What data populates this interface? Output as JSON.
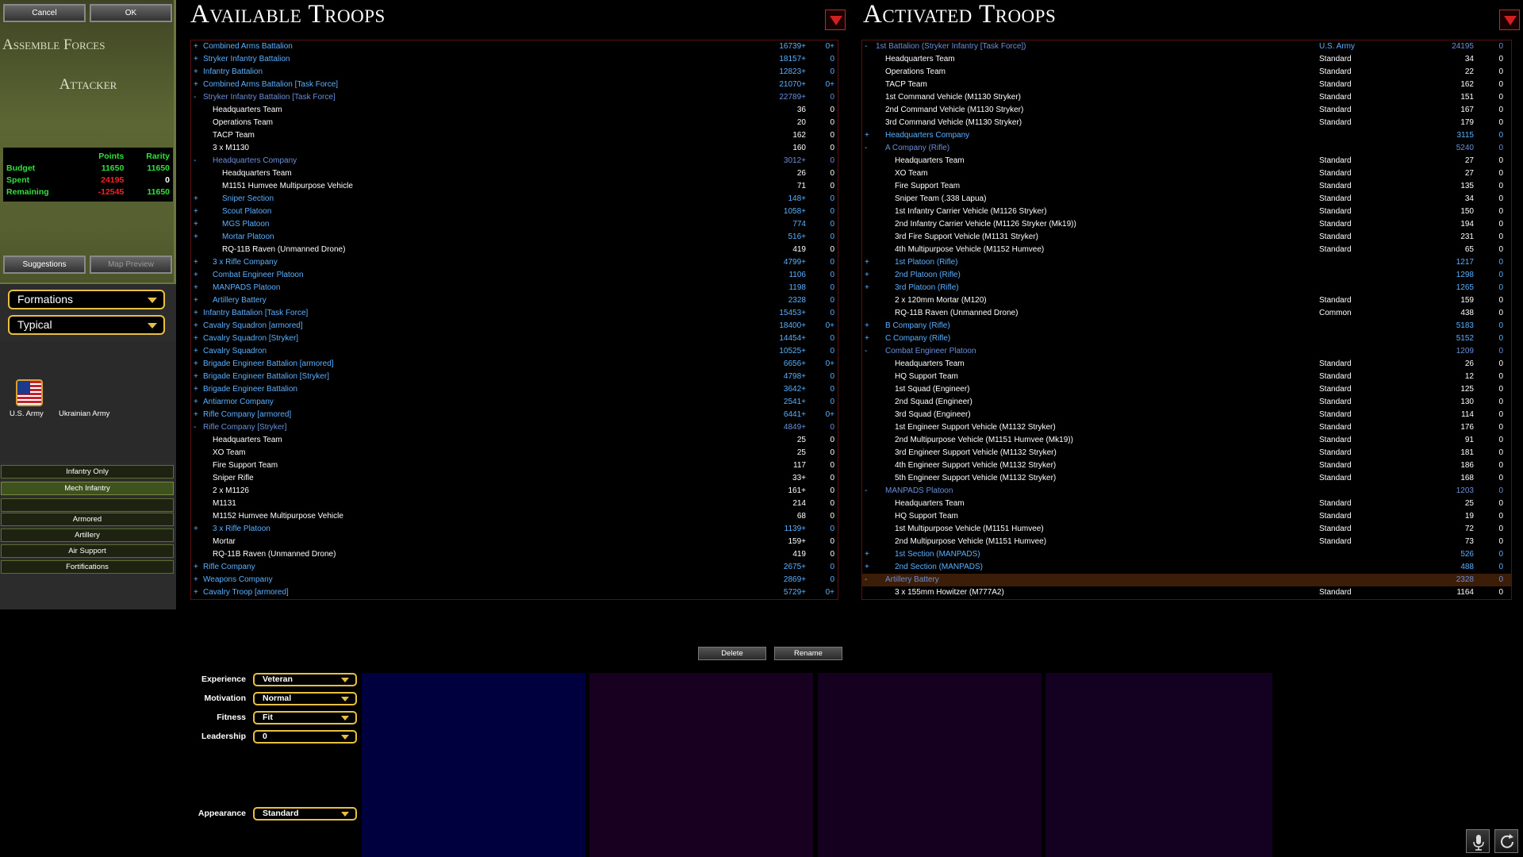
{
  "top_buttons": {
    "cancel": "Cancel",
    "ok": "OK"
  },
  "assemble_title": "Assemble Forces",
  "side": "Attacker",
  "budget": {
    "header": {
      "points": "Points",
      "rarity": "Rarity"
    },
    "rows": [
      {
        "label": "Budget",
        "points": "11650",
        "rarity": "11650"
      },
      {
        "label": "Spent",
        "points": "24195",
        "rarity": "0"
      },
      {
        "label": "Remaining",
        "points": "-12545",
        "rarity": "11650"
      }
    ]
  },
  "buttons": {
    "suggestions": "Suggestions",
    "map_preview": "Map Preview"
  },
  "selects": {
    "formations": "Formations",
    "typical": "Typical"
  },
  "countries": {
    "us": "U.S. Army",
    "ua": "Ukrainian Army"
  },
  "filters": {
    "infantry_only": "Infantry Only",
    "mech_infantry": "Mech Infantry",
    "armored": "Armored",
    "artillery": "Artillery",
    "air_support": "Air Support",
    "fortifications": "Fortifications"
  },
  "titles": {
    "available": "Available Troops",
    "activated": "Activated Troops"
  },
  "available_troops": [
    {
      "exp": "+",
      "name": "Combined Arms Battalion",
      "points": "16739+",
      "rar": "0+",
      "indent": 0,
      "style": "blue"
    },
    {
      "exp": "+",
      "name": "Stryker Infantry Battalion",
      "points": "18157+",
      "rar": "0",
      "indent": 0,
      "style": "blue"
    },
    {
      "exp": "+",
      "name": "Infantry Battalion",
      "points": "12823+",
      "rar": "0",
      "indent": 0,
      "style": "blue"
    },
    {
      "exp": "+",
      "name": "Combined Arms Battalion [Task Force]",
      "points": "21070+",
      "rar": "0+",
      "indent": 0,
      "style": "blue"
    },
    {
      "exp": "-",
      "name": "Stryker Infantry Battalion [Task Force]",
      "points": "22789+",
      "rar": "0",
      "indent": 0,
      "style": "dim"
    },
    {
      "exp": "",
      "name": "Headquarters Team",
      "points": "36",
      "rar": "0",
      "indent": 1,
      "style": "white"
    },
    {
      "exp": "",
      "name": "Operations Team",
      "points": "20",
      "rar": "0",
      "indent": 1,
      "style": "white"
    },
    {
      "exp": "",
      "name": "TACP Team",
      "points": "162",
      "rar": "0",
      "indent": 1,
      "style": "white"
    },
    {
      "exp": "",
      "name": "3 x M1130",
      "points": "160",
      "rar": "0",
      "indent": 1,
      "style": "white"
    },
    {
      "exp": "-",
      "name": "Headquarters Company",
      "points": "3012+",
      "rar": "0",
      "indent": 1,
      "style": "dim"
    },
    {
      "exp": "",
      "name": "Headquarters Team",
      "points": "26",
      "rar": "0",
      "indent": 2,
      "style": "white"
    },
    {
      "exp": "",
      "name": "M1151 Humvee Multipurpose Vehicle",
      "points": "71",
      "rar": "0",
      "indent": 2,
      "style": "white"
    },
    {
      "exp": "+",
      "name": "Sniper Section",
      "points": "148+",
      "rar": "0",
      "indent": 2,
      "style": "blue"
    },
    {
      "exp": "+",
      "name": "Scout Platoon",
      "points": "1058+",
      "rar": "0",
      "indent": 2,
      "style": "blue"
    },
    {
      "exp": "+",
      "name": "MGS Platoon",
      "points": "774",
      "rar": "0",
      "indent": 2,
      "style": "blue"
    },
    {
      "exp": "+",
      "name": "Mortar Platoon",
      "points": "516+",
      "rar": "0",
      "indent": 2,
      "style": "blue"
    },
    {
      "exp": "",
      "name": "RQ-11B Raven (Unmanned Drone)",
      "points": "419",
      "rar": "0",
      "indent": 2,
      "style": "white"
    },
    {
      "exp": "+",
      "name": "3 x Rifle Company",
      "points": "4799+",
      "rar": "0",
      "indent": 1,
      "style": "blue"
    },
    {
      "exp": "+",
      "name": "Combat Engineer Platoon",
      "points": "1106",
      "rar": "0",
      "indent": 1,
      "style": "blue"
    },
    {
      "exp": "+",
      "name": "MANPADS Platoon",
      "points": "1198",
      "rar": "0",
      "indent": 1,
      "style": "blue"
    },
    {
      "exp": "+",
      "name": "Artillery Battery",
      "points": "2328",
      "rar": "0",
      "indent": 1,
      "style": "blue"
    },
    {
      "exp": "+",
      "name": "Infantry Battalion [Task Force]",
      "points": "15453+",
      "rar": "0",
      "indent": 0,
      "style": "blue"
    },
    {
      "exp": "+",
      "name": "Cavalry Squadron [armored]",
      "points": "18400+",
      "rar": "0+",
      "indent": 0,
      "style": "blue"
    },
    {
      "exp": "+",
      "name": "Cavalry Squadron [Stryker]",
      "points": "14454+",
      "rar": "0",
      "indent": 0,
      "style": "blue"
    },
    {
      "exp": "+",
      "name": "Cavalry Squadron",
      "points": "10525+",
      "rar": "0",
      "indent": 0,
      "style": "blue"
    },
    {
      "exp": "+",
      "name": "Brigade Engineer Battalion [armored]",
      "points": "6656+",
      "rar": "0+",
      "indent": 0,
      "style": "blue"
    },
    {
      "exp": "+",
      "name": "Brigade Engineer Battalion [Stryker]",
      "points": "4798+",
      "rar": "0",
      "indent": 0,
      "style": "blue"
    },
    {
      "exp": "+",
      "name": "Brigade Engineer Battalion",
      "points": "3642+",
      "rar": "0",
      "indent": 0,
      "style": "blue"
    },
    {
      "exp": "+",
      "name": "Antiarmor Company",
      "points": "2541+",
      "rar": "0",
      "indent": 0,
      "style": "blue"
    },
    {
      "exp": "+",
      "name": "Rifle Company [armored]",
      "points": "6441+",
      "rar": "0+",
      "indent": 0,
      "style": "blue"
    },
    {
      "exp": "-",
      "name": "Rifle Company [Stryker]",
      "points": "4849+",
      "rar": "0",
      "indent": 0,
      "style": "dim"
    },
    {
      "exp": "",
      "name": "Headquarters Team",
      "points": "25",
      "rar": "0",
      "indent": 1,
      "style": "white"
    },
    {
      "exp": "",
      "name": "XO Team",
      "points": "25",
      "rar": "0",
      "indent": 1,
      "style": "white"
    },
    {
      "exp": "",
      "name": "Fire Support Team",
      "points": "117",
      "rar": "0",
      "indent": 1,
      "style": "white"
    },
    {
      "exp": "",
      "name": "Sniper Rifle",
      "points": "33+",
      "rar": "0",
      "indent": 1,
      "style": "white"
    },
    {
      "exp": "",
      "name": "2 x M1126",
      "points": "161+",
      "rar": "0",
      "indent": 1,
      "style": "white"
    },
    {
      "exp": "",
      "name": "M1131",
      "points": "214",
      "rar": "0",
      "indent": 1,
      "style": "white"
    },
    {
      "exp": "",
      "name": "M1152 Humvee Multipurpose Vehicle",
      "points": "68",
      "rar": "0",
      "indent": 1,
      "style": "white"
    },
    {
      "exp": "+",
      "name": "3 x Rifle Platoon",
      "points": "1139+",
      "rar": "0",
      "indent": 1,
      "style": "blue"
    },
    {
      "exp": "",
      "name": "Mortar",
      "points": "159+",
      "rar": "0",
      "indent": 1,
      "style": "white"
    },
    {
      "exp": "",
      "name": "RQ-11B Raven (Unmanned Drone)",
      "points": "419",
      "rar": "0",
      "indent": 1,
      "style": "white"
    },
    {
      "exp": "+",
      "name": "Rifle Company",
      "points": "2675+",
      "rar": "0",
      "indent": 0,
      "style": "blue"
    },
    {
      "exp": "+",
      "name": "Weapons Company",
      "points": "2869+",
      "rar": "0",
      "indent": 0,
      "style": "blue"
    },
    {
      "exp": "+",
      "name": "Cavalry Troop [armored]",
      "points": "5729+",
      "rar": "0+",
      "indent": 0,
      "style": "blue"
    }
  ],
  "activated_troops": [
    {
      "exp": "-",
      "name": "1st Battalion (Stryker Infantry [Task Force])",
      "rarity": "U.S. Army",
      "points": "24195",
      "rar": "0",
      "indent": 0,
      "style": "dim"
    },
    {
      "exp": "",
      "name": "Headquarters Team",
      "rarity": "Standard",
      "points": "34",
      "rar": "0",
      "indent": 1,
      "style": "white"
    },
    {
      "exp": "",
      "name": "Operations Team",
      "rarity": "Standard",
      "points": "22",
      "rar": "0",
      "indent": 1,
      "style": "white"
    },
    {
      "exp": "",
      "name": "TACP Team",
      "rarity": "Standard",
      "points": "162",
      "rar": "0",
      "indent": 1,
      "style": "white"
    },
    {
      "exp": "",
      "name": "1st Command Vehicle (M1130 Stryker)",
      "rarity": "Standard",
      "points": "151",
      "rar": "0",
      "indent": 1,
      "style": "white"
    },
    {
      "exp": "",
      "name": "2nd Command Vehicle (M1130 Stryker)",
      "rarity": "Standard",
      "points": "167",
      "rar": "0",
      "indent": 1,
      "style": "white"
    },
    {
      "exp": "",
      "name": "3rd Command Vehicle (M1130 Stryker)",
      "rarity": "Standard",
      "points": "179",
      "rar": "0",
      "indent": 1,
      "style": "white"
    },
    {
      "exp": "+",
      "name": "Headquarters Company",
      "rarity": "",
      "points": "3115",
      "rar": "0",
      "indent": 1,
      "style": "blue"
    },
    {
      "exp": "-",
      "name": "A Company (Rifle)",
      "rarity": "",
      "points": "5240",
      "rar": "0",
      "indent": 1,
      "style": "dim"
    },
    {
      "exp": "",
      "name": "Headquarters Team",
      "rarity": "Standard",
      "points": "27",
      "rar": "0",
      "indent": 2,
      "style": "white"
    },
    {
      "exp": "",
      "name": "XO Team",
      "rarity": "Standard",
      "points": "27",
      "rar": "0",
      "indent": 2,
      "style": "white"
    },
    {
      "exp": "",
      "name": "Fire Support Team",
      "rarity": "Standard",
      "points": "135",
      "rar": "0",
      "indent": 2,
      "style": "white"
    },
    {
      "exp": "",
      "name": "Sniper Team (.338 Lapua)",
      "rarity": "Standard",
      "points": "34",
      "rar": "0",
      "indent": 2,
      "style": "white"
    },
    {
      "exp": "",
      "name": "1st Infantry Carrier Vehicle (M1126 Stryker)",
      "rarity": "Standard",
      "points": "150",
      "rar": "0",
      "indent": 2,
      "style": "white"
    },
    {
      "exp": "",
      "name": "2nd Infantry Carrier Vehicle (M1126 Stryker (Mk19))",
      "rarity": "Standard",
      "points": "194",
      "rar": "0",
      "indent": 2,
      "style": "white"
    },
    {
      "exp": "",
      "name": "3rd Fire Support Vehicle (M1131 Stryker)",
      "rarity": "Standard",
      "points": "231",
      "rar": "0",
      "indent": 2,
      "style": "white"
    },
    {
      "exp": "",
      "name": "4th Multipurpose Vehicle (M1152 Humvee)",
      "rarity": "Standard",
      "points": "65",
      "rar": "0",
      "indent": 2,
      "style": "white"
    },
    {
      "exp": "+",
      "name": "1st Platoon (Rifle)",
      "rarity": "",
      "points": "1217",
      "rar": "0",
      "indent": 2,
      "style": "blue"
    },
    {
      "exp": "+",
      "name": "2nd Platoon (Rifle)",
      "rarity": "",
      "points": "1298",
      "rar": "0",
      "indent": 2,
      "style": "blue"
    },
    {
      "exp": "+",
      "name": "3rd Platoon (Rifle)",
      "rarity": "",
      "points": "1265",
      "rar": "0",
      "indent": 2,
      "style": "blue"
    },
    {
      "exp": "",
      "name": "2 x 120mm Mortar (M120)",
      "rarity": "Standard",
      "points": "159",
      "rar": "0",
      "indent": 2,
      "style": "white"
    },
    {
      "exp": "",
      "name": "RQ-11B Raven (Unmanned Drone)",
      "rarity": "Common",
      "points": "438",
      "rar": "0",
      "indent": 2,
      "style": "white"
    },
    {
      "exp": "+",
      "name": "B Company (Rifle)",
      "rarity": "",
      "points": "5183",
      "rar": "0",
      "indent": 1,
      "style": "blue"
    },
    {
      "exp": "+",
      "name": "C Company (Rifle)",
      "rarity": "",
      "points": "5152",
      "rar": "0",
      "indent": 1,
      "style": "blue"
    },
    {
      "exp": "-",
      "name": "Combat Engineer Platoon",
      "rarity": "",
      "points": "1209",
      "rar": "0",
      "indent": 1,
      "style": "dim"
    },
    {
      "exp": "",
      "name": "Headquarters Team",
      "rarity": "Standard",
      "points": "26",
      "rar": "0",
      "indent": 2,
      "style": "white"
    },
    {
      "exp": "",
      "name": "HQ Support Team",
      "rarity": "Standard",
      "points": "12",
      "rar": "0",
      "indent": 2,
      "style": "white"
    },
    {
      "exp": "",
      "name": "1st Squad (Engineer)",
      "rarity": "Standard",
      "points": "125",
      "rar": "0",
      "indent": 2,
      "style": "white"
    },
    {
      "exp": "",
      "name": "2nd Squad (Engineer)",
      "rarity": "Standard",
      "points": "130",
      "rar": "0",
      "indent": 2,
      "style": "white"
    },
    {
      "exp": "",
      "name": "3rd Squad (Engineer)",
      "rarity": "Standard",
      "points": "114",
      "rar": "0",
      "indent": 2,
      "style": "white"
    },
    {
      "exp": "",
      "name": "1st Engineer Support Vehicle (M1132 Stryker)",
      "rarity": "Standard",
      "points": "176",
      "rar": "0",
      "indent": 2,
      "style": "white"
    },
    {
      "exp": "",
      "name": "2nd Multipurpose Vehicle (M1151 Humvee (Mk19))",
      "rarity": "Standard",
      "points": "91",
      "rar": "0",
      "indent": 2,
      "style": "white"
    },
    {
      "exp": "",
      "name": "3rd Engineer Support Vehicle (M1132 Stryker)",
      "rarity": "Standard",
      "points": "181",
      "rar": "0",
      "indent": 2,
      "style": "white"
    },
    {
      "exp": "",
      "name": "4th Engineer Support Vehicle (M1132 Stryker)",
      "rarity": "Standard",
      "points": "186",
      "rar": "0",
      "indent": 2,
      "style": "white"
    },
    {
      "exp": "",
      "name": "5th Engineer Support Vehicle (M1132 Stryker)",
      "rarity": "Standard",
      "points": "168",
      "rar": "0",
      "indent": 2,
      "style": "white"
    },
    {
      "exp": "-",
      "name": "MANPADS Platoon",
      "rarity": "",
      "points": "1203",
      "rar": "0",
      "indent": 1,
      "style": "dim"
    },
    {
      "exp": "",
      "name": "Headquarters Team",
      "rarity": "Standard",
      "points": "25",
      "rar": "0",
      "indent": 2,
      "style": "white"
    },
    {
      "exp": "",
      "name": "HQ Support Team",
      "rarity": "Standard",
      "points": "19",
      "rar": "0",
      "indent": 2,
      "style": "white"
    },
    {
      "exp": "",
      "name": "1st Multipurpose Vehicle (M1151 Humvee)",
      "rarity": "Standard",
      "points": "72",
      "rar": "0",
      "indent": 2,
      "style": "white"
    },
    {
      "exp": "",
      "name": "2nd Multipurpose Vehicle (M1151 Humvee)",
      "rarity": "Standard",
      "points": "73",
      "rar": "0",
      "indent": 2,
      "style": "white"
    },
    {
      "exp": "+",
      "name": "1st Section (MANPADS)",
      "rarity": "",
      "points": "526",
      "rar": "0",
      "indent": 2,
      "style": "blue"
    },
    {
      "exp": "+",
      "name": "2nd Section (MANPADS)",
      "rarity": "",
      "points": "488",
      "rar": "0",
      "indent": 2,
      "style": "blue"
    },
    {
      "exp": "-",
      "name": "Artillery Battery",
      "rarity": "",
      "points": "2328",
      "rar": "0",
      "indent": 1,
      "style": "dim",
      "selected": true
    },
    {
      "exp": "",
      "name": "3 x 155mm Howitzer (M777A2)",
      "rarity": "Standard",
      "points": "1164",
      "rar": "0",
      "indent": 2,
      "style": "white"
    }
  ],
  "bottom_buttons": {
    "delete": "Delete",
    "rename": "Rename"
  },
  "attributes": {
    "experience": {
      "label": "Experience",
      "value": "Veteran"
    },
    "motivation": {
      "label": "Motivation",
      "value": "Normal"
    },
    "fitness": {
      "label": "Fitness",
      "value": "Fit"
    },
    "leadership": {
      "label": "Leadership",
      "value": "0"
    },
    "appearance": {
      "label": "Appearance",
      "value": "Standard"
    }
  },
  "icons": {
    "microphone": "microphone-icon",
    "refresh": "refresh-icon"
  },
  "colors": {
    "accent_yellow": "#e8c040",
    "list_blue": "#5ab0ff",
    "budget_green": "#2fe23a",
    "budget_red": "#ff2020",
    "panel_border": "#5a1010",
    "selected_row": "#3b1d08"
  }
}
